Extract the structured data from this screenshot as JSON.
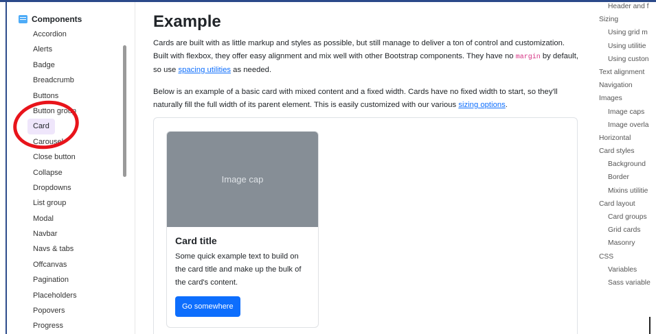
{
  "sidebar": {
    "header": "Components",
    "items": [
      {
        "label": "Accordion"
      },
      {
        "label": "Alerts"
      },
      {
        "label": "Badge"
      },
      {
        "label": "Breadcrumb"
      },
      {
        "label": "Buttons"
      },
      {
        "label": "Button group"
      },
      {
        "label": "Card",
        "active": true
      },
      {
        "label": "Carousel"
      },
      {
        "label": "Close button"
      },
      {
        "label": "Collapse"
      },
      {
        "label": "Dropdowns"
      },
      {
        "label": "List group"
      },
      {
        "label": "Modal"
      },
      {
        "label": "Navbar"
      },
      {
        "label": "Navs & tabs"
      },
      {
        "label": "Offcanvas"
      },
      {
        "label": "Pagination"
      },
      {
        "label": "Placeholders"
      },
      {
        "label": "Popovers"
      },
      {
        "label": "Progress"
      }
    ]
  },
  "main": {
    "title": "Example",
    "p1_a": "Cards are built with as little markup and styles as possible, but still manage to deliver a ton of control and customization. Built with flexbox, they offer easy alignment and mix well with other Bootstrap components. They have no ",
    "p1_code": "margin",
    "p1_b": " by default, so use ",
    "p1_link": "spacing utilities",
    "p1_c": " as needed.",
    "p2_a": "Below is an example of a basic card with mixed content and a fixed width. Cards have no fixed width to start, so they'll naturally fill the full width of its parent element. This is easily customized with our various ",
    "p2_link": "sizing options",
    "p2_b": "."
  },
  "card": {
    "image_cap": "Image cap",
    "title": "Card title",
    "text": "Some quick example text to build on the card title and make up the bulk of the card's content.",
    "button": "Go somewhere"
  },
  "toc": {
    "items": [
      {
        "label": "Header and f",
        "sub": true
      },
      {
        "label": "Sizing",
        "sub": false
      },
      {
        "label": "Using grid m",
        "sub": true
      },
      {
        "label": "Using utilitie",
        "sub": true
      },
      {
        "label": "Using custon",
        "sub": true
      },
      {
        "label": "Text alignment",
        "sub": false
      },
      {
        "label": "Navigation",
        "sub": false
      },
      {
        "label": "Images",
        "sub": false
      },
      {
        "label": "Image caps",
        "sub": true
      },
      {
        "label": "Image overla",
        "sub": true
      },
      {
        "label": "Horizontal",
        "sub": false
      },
      {
        "label": "Card styles",
        "sub": false
      },
      {
        "label": "Background",
        "sub": true
      },
      {
        "label": "Border",
        "sub": true
      },
      {
        "label": "Mixins utilitie",
        "sub": true
      },
      {
        "label": "Card layout",
        "sub": false
      },
      {
        "label": "Card groups",
        "sub": true
      },
      {
        "label": "Grid cards",
        "sub": true
      },
      {
        "label": "Masonry",
        "sub": true
      },
      {
        "label": "CSS",
        "sub": false
      },
      {
        "label": "Variables",
        "sub": true
      },
      {
        "label": "Sass variable",
        "sub": true
      }
    ]
  },
  "colors": {
    "accent": "#0d6efd",
    "active_bg": "#efe6fb",
    "annotation": "#e8141b",
    "image_cap_bg": "#868e96"
  }
}
